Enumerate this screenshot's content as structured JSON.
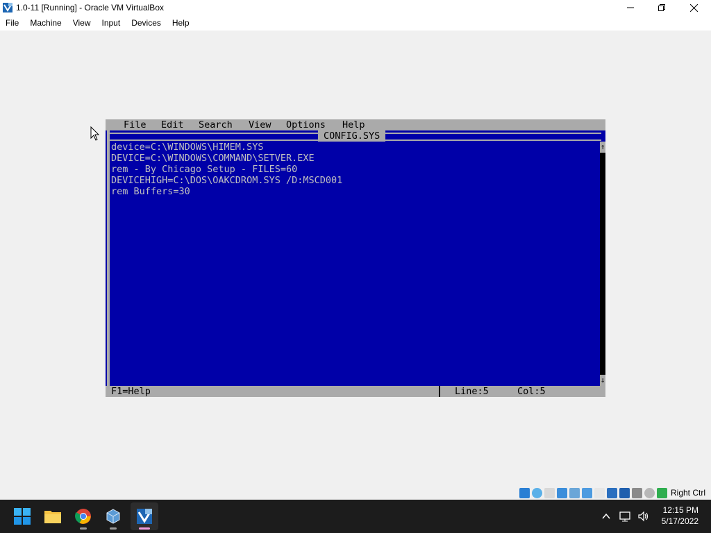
{
  "window": {
    "title": "1.0-11 [Running] - Oracle VM VirtualBox",
    "icon": "virtualbox-icon",
    "controls": [
      "minimize-icon",
      "restore-icon",
      "close-icon"
    ]
  },
  "menubar": {
    "items": [
      "File",
      "Machine",
      "View",
      "Input",
      "Devices",
      "Help"
    ]
  },
  "dos_editor": {
    "menu": [
      "File",
      "Edit",
      "Search",
      "View",
      "Options",
      "Help"
    ],
    "file_title": "CONFIG.SYS",
    "lines": [
      "device=C:\\WINDOWS\\HIMEM.SYS",
      "DEVICE=C:\\WINDOWS\\COMMAND\\SETVER.EXE",
      "rem - By Chicago Setup - FILES=60",
      "DEVICEHIGH=C:\\DOS\\OAKCDROM.SYS /D:MSCD001",
      "rem Buffers=30"
    ],
    "status": {
      "help": "F1=Help",
      "line": "Line:5",
      "col": "Col:5"
    },
    "colors": {
      "background": "#0000a8",
      "text": "#c0c0c0",
      "chrome": "#aaaaaa"
    }
  },
  "vbox_status": {
    "icons": [
      "hard-disk-icon",
      "optical-drive-icon",
      "floppy-icon",
      "network-icon",
      "usb-icon",
      "shared-folders-icon",
      "display-icon",
      "recording-icon",
      "cpu-icon",
      "mouse-integration-icon",
      "keyboard-icon"
    ],
    "host_key": "Right Ctrl"
  },
  "taskbar": {
    "apps": [
      "windows-start-icon",
      "file-explorer-icon",
      "chrome-icon",
      "virtualbox-manager-icon",
      "virtualbox-vm-icon"
    ],
    "tray_icons": [
      "chevron-up-icon",
      "network-icon",
      "volume-icon"
    ],
    "time": "12:15 PM",
    "date": "5/17/2022"
  }
}
